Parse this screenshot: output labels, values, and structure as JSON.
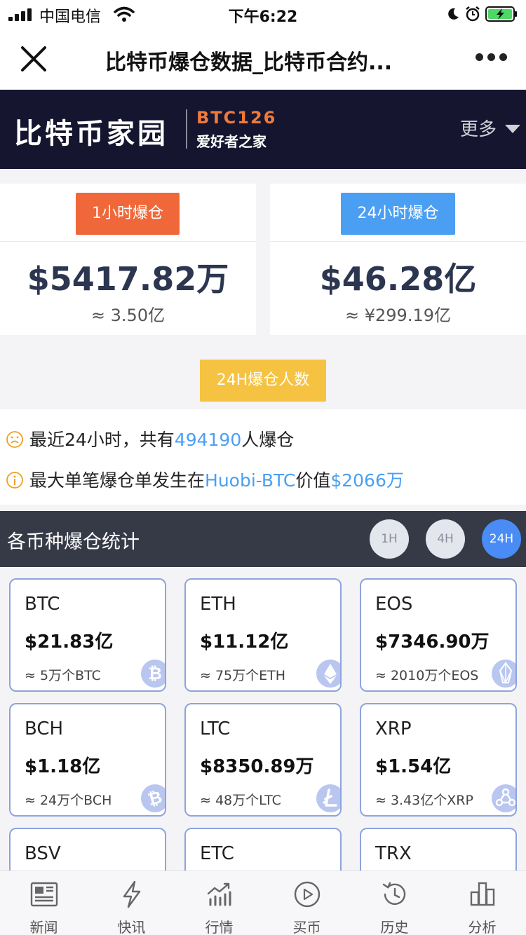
{
  "status_bar": {
    "carrier": "中国电信",
    "time": "下午6:22"
  },
  "nav": {
    "title": "比特币爆仓数据_比特币合约..."
  },
  "site": {
    "logo_cn": "比特币家园",
    "logo_en": "BTC126",
    "logo_sub": "爱好者之家",
    "more_label": "更多"
  },
  "summary": {
    "hour": {
      "badge": "1小时爆仓",
      "value": "$5417.82万",
      "sub": "≈ 3.50亿",
      "color": "#f0683a"
    },
    "day": {
      "badge": "24小时爆仓",
      "value": "$46.28亿",
      "sub": "≈ ¥299.19亿",
      "color": "#4a9ff2"
    },
    "people_badge": "24H爆仓人数"
  },
  "info": {
    "line1_prefix": "最近24小时，共有",
    "line1_count": "494190",
    "line1_suffix": "人爆仓",
    "line2_prefix": "最大单笔爆仓单发生在",
    "line2_exchange": "Huobi-BTC",
    "line2_mid": "价值",
    "line2_value": "$2066万"
  },
  "stats": {
    "title": "各币种爆仓统计",
    "timeframes": [
      "1H",
      "4H",
      "24H"
    ],
    "active_timeframe": "24H"
  },
  "coins": [
    {
      "symbol": "BTC",
      "value": "$21.83亿",
      "sub": "≈ 5万个BTC",
      "icon": "bitcoin-icon"
    },
    {
      "symbol": "ETH",
      "value": "$11.12亿",
      "sub": "≈ 75万个ETH",
      "icon": "ethereum-icon"
    },
    {
      "symbol": "EOS",
      "value": "$7346.90万",
      "sub": "≈ 2010万个EOS",
      "icon": "eos-icon"
    },
    {
      "symbol": "BCH",
      "value": "$1.18亿",
      "sub": "≈ 24万个BCH",
      "icon": "bitcoin-cash-icon"
    },
    {
      "symbol": "LTC",
      "value": "$8350.89万",
      "sub": "≈ 48万个LTC",
      "icon": "litecoin-icon"
    },
    {
      "symbol": "XRP",
      "value": "$1.54亿",
      "sub": "≈ 3.43亿个XRP",
      "icon": "ripple-icon"
    },
    {
      "symbol": "BSV",
      "value": "",
      "sub": "",
      "icon": ""
    },
    {
      "symbol": "ETC",
      "value": "",
      "sub": "",
      "icon": ""
    },
    {
      "symbol": "TRX",
      "value": "",
      "sub": "",
      "icon": ""
    }
  ],
  "tabbar": {
    "items": [
      {
        "label": "新闻",
        "icon": "newspaper-icon"
      },
      {
        "label": "快讯",
        "icon": "lightning-icon"
      },
      {
        "label": "行情",
        "icon": "chart-icon"
      },
      {
        "label": "买币",
        "icon": "play-circle-icon"
      },
      {
        "label": "历史",
        "icon": "history-icon"
      },
      {
        "label": "分析",
        "icon": "bar-chart-icon"
      }
    ]
  }
}
